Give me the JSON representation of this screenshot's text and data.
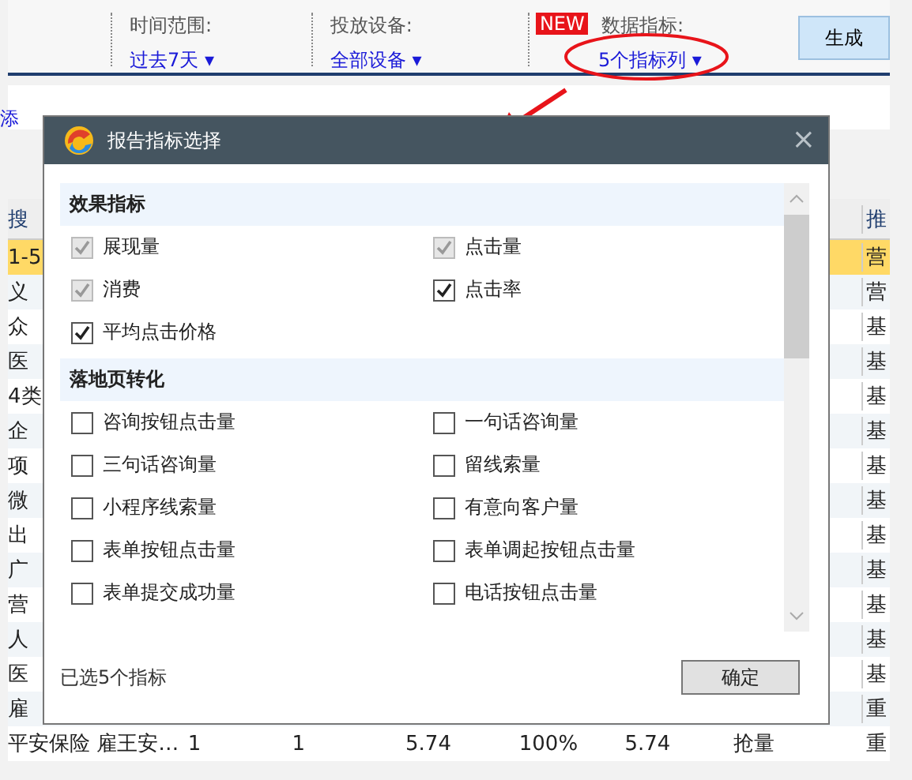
{
  "toolbar": {
    "filters": [
      {
        "label": "时间范围:",
        "value": "过去7天",
        "caret": "▾"
      },
      {
        "label": "投放设备:",
        "value": "全部设备",
        "caret": "▾"
      },
      {
        "label": "数据指标:",
        "value": "5个指标列",
        "caret": "▾",
        "badge": "NEW"
      }
    ],
    "generate_button": "生成"
  },
  "link_fragment": "添",
  "table": {
    "header": [
      {
        "text": "搜"
      },
      {
        "text": "推"
      }
    ],
    "rows": [
      {
        "cells": [
          "1-5",
          "营"
        ],
        "selected": true
      },
      {
        "cells": [
          "义",
          "营"
        ],
        "selected": false
      },
      {
        "cells": [
          "众",
          "基"
        ],
        "selected": false
      },
      {
        "cells": [
          "医",
          "基"
        ],
        "selected": false
      },
      {
        "cells": [
          "4类",
          "基"
        ],
        "selected": false
      },
      {
        "cells": [
          "企",
          "基"
        ],
        "selected": false
      },
      {
        "cells": [
          "项",
          "基"
        ],
        "selected": false
      },
      {
        "cells": [
          "微",
          "基"
        ],
        "selected": false
      },
      {
        "cells": [
          "出",
          "基"
        ],
        "selected": false
      },
      {
        "cells": [
          "广",
          "基"
        ],
        "selected": false
      },
      {
        "cells": [
          "营",
          "基"
        ],
        "selected": false
      },
      {
        "cells": [
          "人",
          "基"
        ],
        "selected": false
      },
      {
        "cells": [
          "医",
          "基"
        ],
        "selected": false
      },
      {
        "cells": [
          "雇",
          "重"
        ],
        "selected": false
      },
      {
        "cells": [
          "平安保险 雇王安…",
          "1",
          "1",
          "5.74",
          "100%",
          "5.74",
          "抢量",
          "重"
        ],
        "selected": false
      }
    ]
  },
  "dialog": {
    "title": "报告指标选择",
    "close": "×",
    "sections": [
      {
        "title": "效果指标",
        "items": [
          {
            "label": "展现量",
            "checked": true,
            "disabled": true
          },
          {
            "label": "点击量",
            "checked": true,
            "disabled": true
          },
          {
            "label": "消费",
            "checked": true,
            "disabled": true
          },
          {
            "label": "点击率",
            "checked": true,
            "disabled": false
          },
          {
            "label": "平均点击价格",
            "checked": true,
            "disabled": false
          }
        ]
      },
      {
        "title": "落地页转化",
        "items": [
          {
            "label": "咨询按钮点击量",
            "checked": false,
            "disabled": false
          },
          {
            "label": "一句话咨询量",
            "checked": false,
            "disabled": false
          },
          {
            "label": "三句话咨询量",
            "checked": false,
            "disabled": false
          },
          {
            "label": "留线索量",
            "checked": false,
            "disabled": false
          },
          {
            "label": "小程序线索量",
            "checked": false,
            "disabled": false
          },
          {
            "label": "有意向客户量",
            "checked": false,
            "disabled": false
          },
          {
            "label": "表单按钮点击量",
            "checked": false,
            "disabled": false
          },
          {
            "label": "表单调起按钮点击量",
            "checked": false,
            "disabled": false
          },
          {
            "label": "表单提交成功量",
            "checked": false,
            "disabled": false
          },
          {
            "label": "电话按钮点击量",
            "checked": false,
            "disabled": false
          }
        ]
      }
    ],
    "summary": "已选5个指标",
    "confirm": "确定"
  }
}
